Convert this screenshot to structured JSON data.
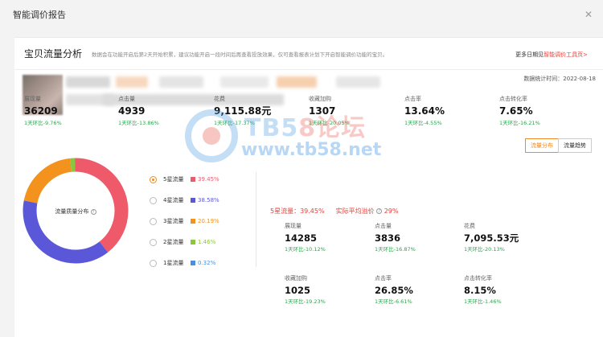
{
  "modal": {
    "title": "智能调价报告"
  },
  "panel": {
    "title": "宝贝流量分析",
    "desc": "数据会在功能开启后第2天开始积累，建议功能开启一段时间后再查看投放效果，仅可查看报表计划下开启智能调价功能的宝贝。",
    "more_prefix": "更多日期见",
    "more_link": "智能调价工具页>"
  },
  "stat_time": "数据统计时间：2022-08-18",
  "metrics": [
    {
      "label": "展现量",
      "value": "36209",
      "change": "1天环比-9.76%"
    },
    {
      "label": "点击量",
      "value": "4939",
      "change": "1天环比-13.86%"
    },
    {
      "label": "花费",
      "value": "9,115.88元",
      "change": "1天环比-17.37%"
    },
    {
      "label": "收藏加购",
      "value": "1307",
      "change": "1天环比-20.05%"
    },
    {
      "label": "点击率",
      "value": "13.64%",
      "change": "1天环比-4.55%"
    },
    {
      "label": "点击转化率",
      "value": "7.65%",
      "change": "1天环比-16.21%"
    }
  ],
  "watermark": {
    "brand_a": "TB5",
    "brand_b": "8论坛",
    "url": "www.tb58.net"
  },
  "view_buttons": [
    {
      "label": "流量分布",
      "active": true
    },
    {
      "label": "流量趋势",
      "active": false
    }
  ],
  "donut": {
    "center_label": "流量质量分布"
  },
  "chart_data": {
    "type": "pie",
    "title": "",
    "categories": [
      "5星流量",
      "4星流量",
      "3星流量",
      "2星流量",
      "1星流量"
    ],
    "values": [
      39.45,
      38.58,
      20.19,
      1.46,
      0.32
    ],
    "labels": [
      "39.45%",
      "38.58%",
      "20.19%",
      "1.46%",
      "0.32%"
    ],
    "colors": [
      "#ef5a6a",
      "#5b57d9",
      "#f4921e",
      "#8cc63e",
      "#4a90e2"
    ],
    "legend_position": "right",
    "selected": 0
  },
  "detail": {
    "star_label": "5星流量：39.45%",
    "price_label": "实际平均溢价",
    "price_value": "29%",
    "metrics": [
      {
        "label": "展现量",
        "value": "14285",
        "change": "1天环比-10.12%"
      },
      {
        "label": "点击量",
        "value": "3836",
        "change": "1天环比-16.87%"
      },
      {
        "label": "花费",
        "value": "7,095.53元",
        "change": "1天环比-20.13%"
      },
      {
        "label": "收藏加购",
        "value": "1025",
        "change": "1天环比-19.23%"
      },
      {
        "label": "点击率",
        "value": "26.85%",
        "change": "1天环比-6.61%"
      },
      {
        "label": "点击转化率",
        "value": "8.15%",
        "change": "1天环比-1.46%"
      }
    ]
  }
}
